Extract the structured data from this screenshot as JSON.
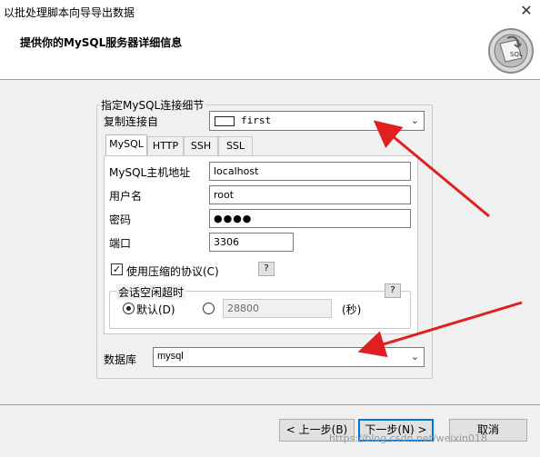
{
  "window": {
    "title": "以批处理脚本向导导出数据",
    "close_glyph": "✕",
    "subtitle": "提供你的MySQL服务器详细信息"
  },
  "group": {
    "title": "指定MySQL连接细节",
    "copy_from_label": "复制连接自",
    "copy_from_value": "first"
  },
  "tabs": [
    {
      "label": "MySQL"
    },
    {
      "label": "HTTP"
    },
    {
      "label": "SSH"
    },
    {
      "label": "SSL"
    }
  ],
  "fields": {
    "host_label": "MySQL主机地址",
    "host_value": "localhost",
    "user_label": "用户名",
    "user_value": "root",
    "password_label": "密码",
    "password_value": "●●●●",
    "port_label": "端口",
    "port_value": "3306"
  },
  "compression": {
    "label": "使用压缩的协议(C)",
    "checked": true,
    "help": "?"
  },
  "timeout": {
    "title": "会话空闲超时",
    "default_label": "默认(D)",
    "custom_value": "28800",
    "unit": "(秒)",
    "help": "?"
  },
  "database": {
    "label": "数据库",
    "value": "mysql"
  },
  "buttons": {
    "back": "< 上一步(B)",
    "next": "下一步(N) >",
    "cancel": "取消"
  },
  "watermark": "https://blog.csdn.net/weixin018",
  "colors": {
    "annotation_arrow": "#e02020",
    "focus": "#0078d7"
  },
  "icons": {
    "logo": "sql-logo-icon",
    "dropdown": "chevron-down-icon",
    "close": "close-icon"
  }
}
